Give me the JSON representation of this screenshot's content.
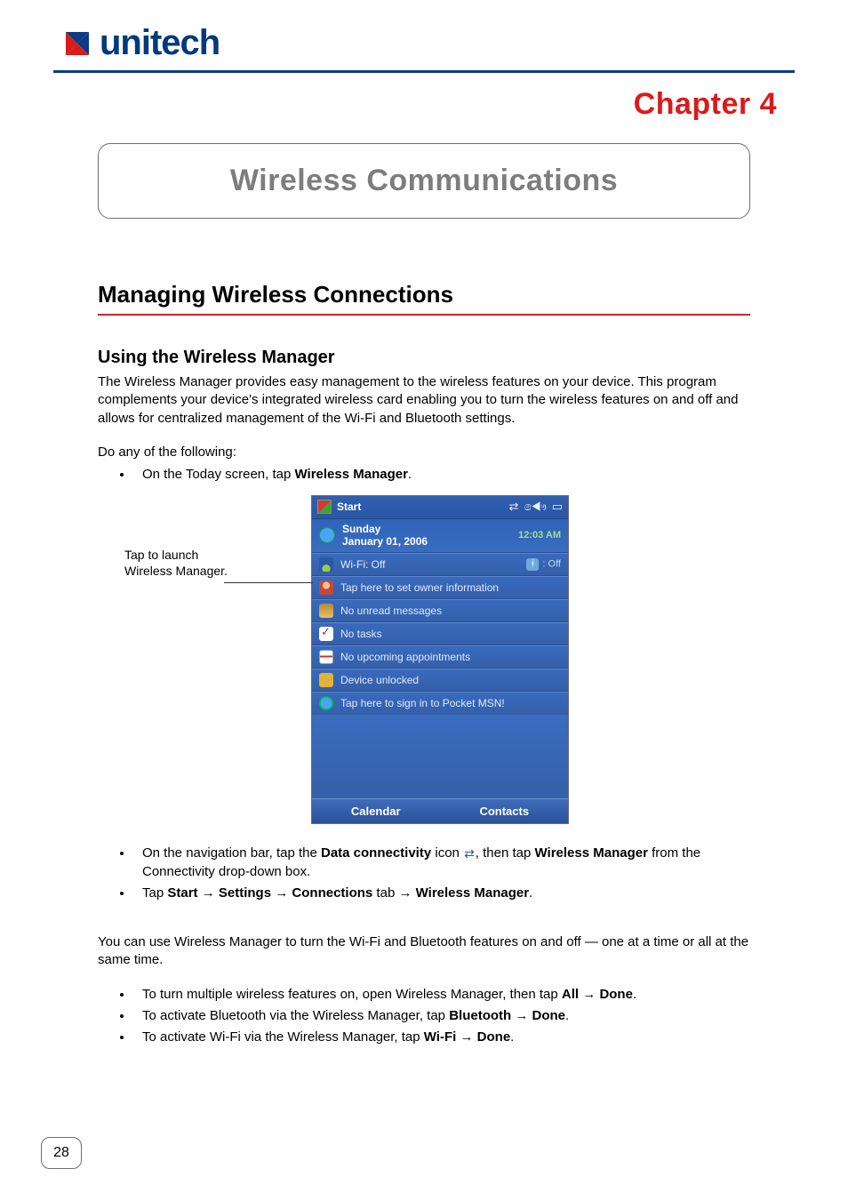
{
  "header": {
    "brand": "unitech",
    "chapter": "Chapter  4",
    "title": "Wireless Communications"
  },
  "section": {
    "h2": "Managing Wireless Connections",
    "h3": "Using the Wireless Manager",
    "intro": "The Wireless Manager provides easy management to the wireless features on your device. This program complements your device's integrated wireless card enabling you to turn the wireless features on and off and allows for centralized management of the Wi-Fi and Bluetooth settings.",
    "lead": "Do any of the following:",
    "bullet1_pre": "On the Today screen, tap ",
    "bullet1_bold": "Wireless Manager",
    "bullet1_post": "."
  },
  "callout": {
    "line1": "Tap to launch",
    "line2": "Wireless Manager."
  },
  "screenshot": {
    "start": "Start",
    "day": "Sunday",
    "date": "January 01, 2006",
    "time": "12:03 AM",
    "rows": {
      "wifi": "Wi-Fi: Off",
      "bt_status": ": Off",
      "owner": "Tap here to set owner information",
      "msgs": "No unread messages",
      "tasks": "No tasks",
      "appts": "No upcoming appointments",
      "lock": "Device unlocked",
      "msn": "Tap here to sign in to Pocket MSN!"
    },
    "soft_left": "Calendar",
    "soft_right": "Contacts"
  },
  "after": {
    "b2_a": "On the navigation bar, tap the ",
    "b2_b": "Data connectivity",
    "b2_c": " icon ",
    "b2_d": ", then tap ",
    "b2_e": "Wireless Manager",
    "b2_f": " from the Connectivity drop-down box.",
    "b3_a": "Tap ",
    "b3_b": "Start",
    "b3_c": "Settings",
    "b3_d": "Connections",
    "b3_e": " tab ",
    "b3_f": "Wireless Manager",
    "arrow": " → ",
    "period": "."
  },
  "usage": {
    "p": "You can use Wireless Manager to turn the Wi-Fi and Bluetooth features on and off — one at a time or all at the same time.",
    "u1_a": "To turn multiple wireless features on, open Wireless Manager, then tap ",
    "u1_b": "All",
    "u1_c": "Done",
    "u2_a": "To activate Bluetooth via the Wireless Manager, tap ",
    "u2_b": "Bluetooth",
    "u2_c": "Done",
    "u3_a": "To activate Wi-Fi via the Wireless Manager, tap ",
    "u3_b": "Wi-Fi",
    "u3_c": "Done"
  },
  "page": "28"
}
